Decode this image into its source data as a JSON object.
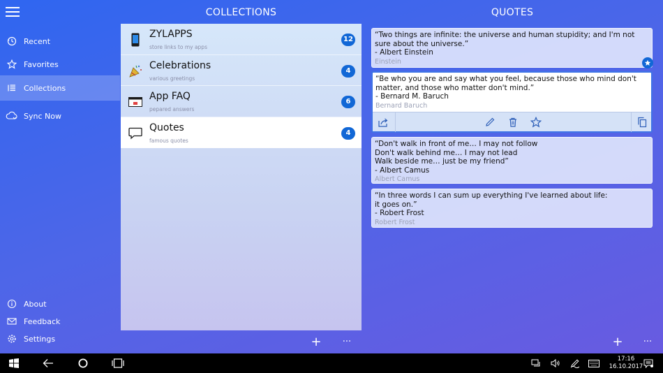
{
  "header": {
    "collections_title": "COLLECTIONS",
    "quotes_title": "QUOTES"
  },
  "sidebar": {
    "items": [
      {
        "label": "Recent",
        "icon": "history-icon"
      },
      {
        "label": "Favorites",
        "icon": "star-icon"
      },
      {
        "label": "Collections",
        "icon": "list-icon",
        "active": true
      },
      {
        "label": "Sync Now",
        "icon": "cloud-sync-icon"
      }
    ],
    "footer_items": [
      {
        "label": "About",
        "icon": "info-icon"
      },
      {
        "label": "Feedback",
        "icon": "mail-icon"
      },
      {
        "label": "Settings",
        "icon": "gear-icon"
      }
    ]
  },
  "collections": [
    {
      "title": "ZYLAPPS",
      "subtitle": "store links to my apps",
      "count": "12",
      "icon": "phone-icon"
    },
    {
      "title": "Celebrations",
      "subtitle": "various greetings",
      "count": "4",
      "icon": "party-popper-icon"
    },
    {
      "title": "App FAQ",
      "subtitle": "pepared answers",
      "count": "6",
      "icon": "faq-card-icon"
    },
    {
      "title": "Quotes",
      "subtitle": "famous quotes",
      "count": "4",
      "icon": "speech-bubble-icon",
      "selected": true
    }
  ],
  "quotes": [
    {
      "text": "“Two things are infinite: the universe and human stupidity; and I'm not sure about the universe.”\n- Albert Einstein",
      "author": "Einstein",
      "favorite": true
    },
    {
      "text": "“Be who you are and say what you feel, because those who mind don't matter, and those who matter don't mind.”\n- Bernard M. Baruch",
      "author": "Bernard Baruch",
      "selected": true
    },
    {
      "text": "“Don't walk in front of me… I may not follow\nDon't walk behind me… I may not lead\nWalk beside me… just be my friend”\n- Albert Camus",
      "author": "Albert Camus"
    },
    {
      "text": "“In three words I can sum up everything I've learned about life:\nit goes on.”\n- Robert Frost",
      "author": "Robert Frost"
    }
  ],
  "appbar": {
    "add_symbol": "+",
    "more_symbol": "···"
  },
  "taskbar": {
    "time": "17:16",
    "date": "16.10.2017"
  },
  "colors": {
    "accent": "#1167d6",
    "selected_border": "#3f73e6"
  }
}
